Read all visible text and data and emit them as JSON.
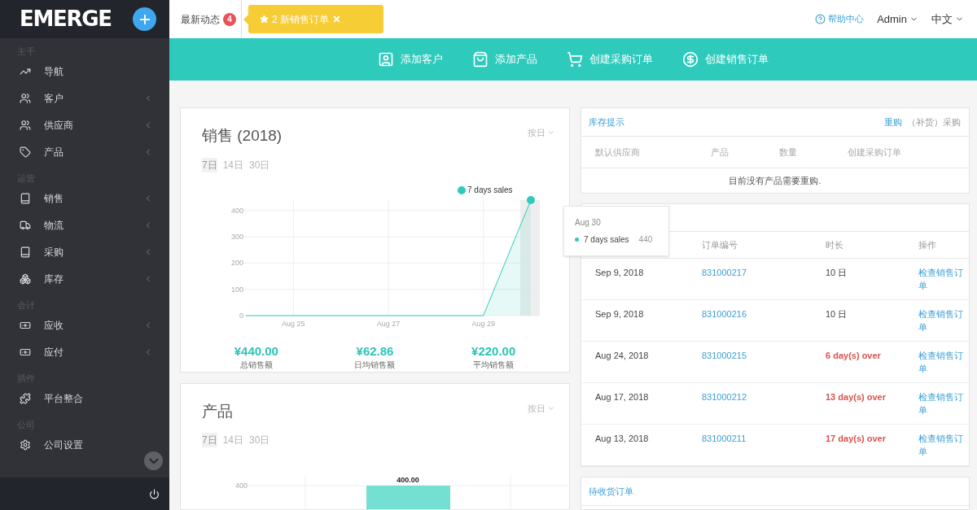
{
  "sidebar": {
    "logo": "EMERGE",
    "sections": [
      {
        "title": "主干",
        "items": [
          {
            "label": "导航",
            "expandable": false
          },
          {
            "label": "客户",
            "expandable": true
          },
          {
            "label": "供应商",
            "expandable": true
          },
          {
            "label": "产品",
            "expandable": true
          }
        ]
      },
      {
        "title": "运营",
        "items": [
          {
            "label": "销售",
            "expandable": true
          },
          {
            "label": "物流",
            "expandable": true
          },
          {
            "label": "采购",
            "expandable": true
          },
          {
            "label": "库存",
            "expandable": true
          }
        ]
      },
      {
        "title": "会计",
        "items": [
          {
            "label": "应收",
            "expandable": true
          },
          {
            "label": "应付",
            "expandable": true
          }
        ]
      },
      {
        "title": "插件",
        "items": [
          {
            "label": "平台整合",
            "expandable": false
          }
        ]
      },
      {
        "title": "公司",
        "items": [
          {
            "label": "公司设置",
            "expandable": false
          }
        ]
      }
    ]
  },
  "topbar": {
    "news_label": "最新动态",
    "news_count": "4",
    "notification": "2 新销售订单",
    "help": "帮助中心",
    "user": "Admin",
    "language": "中文"
  },
  "actions": [
    "添加客户",
    "添加产品",
    "创建采购订单",
    "创建销售订单"
  ],
  "sales_card": {
    "title": "销售 (2018)",
    "period": "按日",
    "ranges": [
      {
        "label": "7日",
        "selected": true
      },
      {
        "label": "14日",
        "selected": false
      },
      {
        "label": "30日",
        "selected": false
      }
    ],
    "chart_data": {
      "type": "area",
      "categories": [
        null,
        "Aug 25",
        null,
        "Aug 27",
        null,
        "Aug 29",
        null
      ],
      "series": [
        {
          "name": "7 days sales",
          "color": "#2ecbbd",
          "values": [
            0,
            0,
            0,
            0,
            0,
            0,
            440
          ]
        }
      ],
      "yticks": [
        0,
        100,
        200,
        300,
        400
      ],
      "ylim": [
        0,
        440
      ],
      "grid": true
    },
    "stats": [
      {
        "value": "¥440.00",
        "label": "总销售额"
      },
      {
        "value": "¥62.86",
        "label": "日均销售额"
      },
      {
        "value": "¥220.00",
        "label": "平均销售额"
      }
    ]
  },
  "tooltip": {
    "date": "Aug 30",
    "series": "7 days sales",
    "value": "440"
  },
  "products_card": {
    "title": "产品",
    "period": "按日",
    "ranges": [
      {
        "label": "7日",
        "selected": true
      },
      {
        "label": "14日",
        "selected": false
      },
      {
        "label": "30日",
        "selected": false
      }
    ],
    "chart": {
      "y_tick": "400",
      "bar_label": "400.00"
    }
  },
  "stock_card": {
    "title": "库存提示",
    "modes": [
      {
        "label": "重购",
        "selected": true
      },
      {
        "label": "（补货）采购",
        "selected": false
      }
    ],
    "columns": [
      "默认供应商",
      "产品",
      "数量",
      "创建采购订单"
    ],
    "empty_message": "目前没有产品需要重购."
  },
  "orders_card": {
    "columns": [
      "订单编号",
      "时长",
      "操作"
    ],
    "rows": [
      {
        "date": "Sep 9, 2018",
        "number": "831000217",
        "duration": "10 日",
        "overdue": false,
        "action": "检查销售订单"
      },
      {
        "date": "Sep 9, 2018",
        "number": "831000216",
        "duration": "10 日",
        "overdue": false,
        "action": "检查销售订单"
      },
      {
        "date": "Aug 24, 2018",
        "number": "831000215",
        "duration": "6 day(s) over",
        "overdue": true,
        "action": "检查销售订单"
      },
      {
        "date": "Aug 17, 2018",
        "number": "831000212",
        "duration": "13 day(s) over",
        "overdue": true,
        "action": "检查销售订单"
      },
      {
        "date": "Aug 13, 2018",
        "number": "831000211",
        "duration": "17 day(s) over",
        "overdue": true,
        "action": "检查销售订单"
      }
    ]
  },
  "pending_card": {
    "title": "待收货订单"
  }
}
